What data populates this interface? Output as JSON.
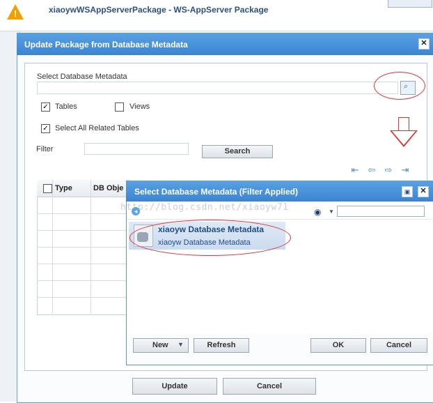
{
  "background": {
    "title": "xiaoywWSAppServerPackage - WS-AppServer Package"
  },
  "main_dialog": {
    "title": "Update Package from Database Metadata",
    "select_label": "Select Database Metadata",
    "tables_label": "Tables",
    "tables_checked": true,
    "views_label": "Views",
    "views_checked": false,
    "related_label": "Select All Related Tables",
    "related_checked": true,
    "filter_label": "Filter",
    "search_label": "Search",
    "columns": [
      "Type",
      "DB Obje"
    ],
    "update_label": "Update",
    "cancel_label": "Cancel",
    "close_glyph": "✕"
  },
  "popup": {
    "title": "Select Database Metadata (Filter Applied)",
    "watermark": "http://blog.csdn.net/xiaoyw71",
    "item_title": "xiaoyw Database Metadata",
    "item_subtitle": "xiaoyw Database Metadata",
    "new_label": "New",
    "refresh_label": "Refresh",
    "ok_label": "OK",
    "cancel_label": "Cancel",
    "close_glyph": "✕"
  },
  "icons": {
    "warning": "warning-icon",
    "browse": "search-icon",
    "nav": [
      "first-icon",
      "prev-icon",
      "next-icon",
      "last-icon"
    ],
    "pin": "pin-icon",
    "back": "back-icon",
    "binoculars": "binoculars-icon",
    "database": "database-icon"
  },
  "colors": {
    "title_bar": "#3b84d2",
    "annotation": "#dd3333",
    "link_text": "#1e4d8c"
  }
}
